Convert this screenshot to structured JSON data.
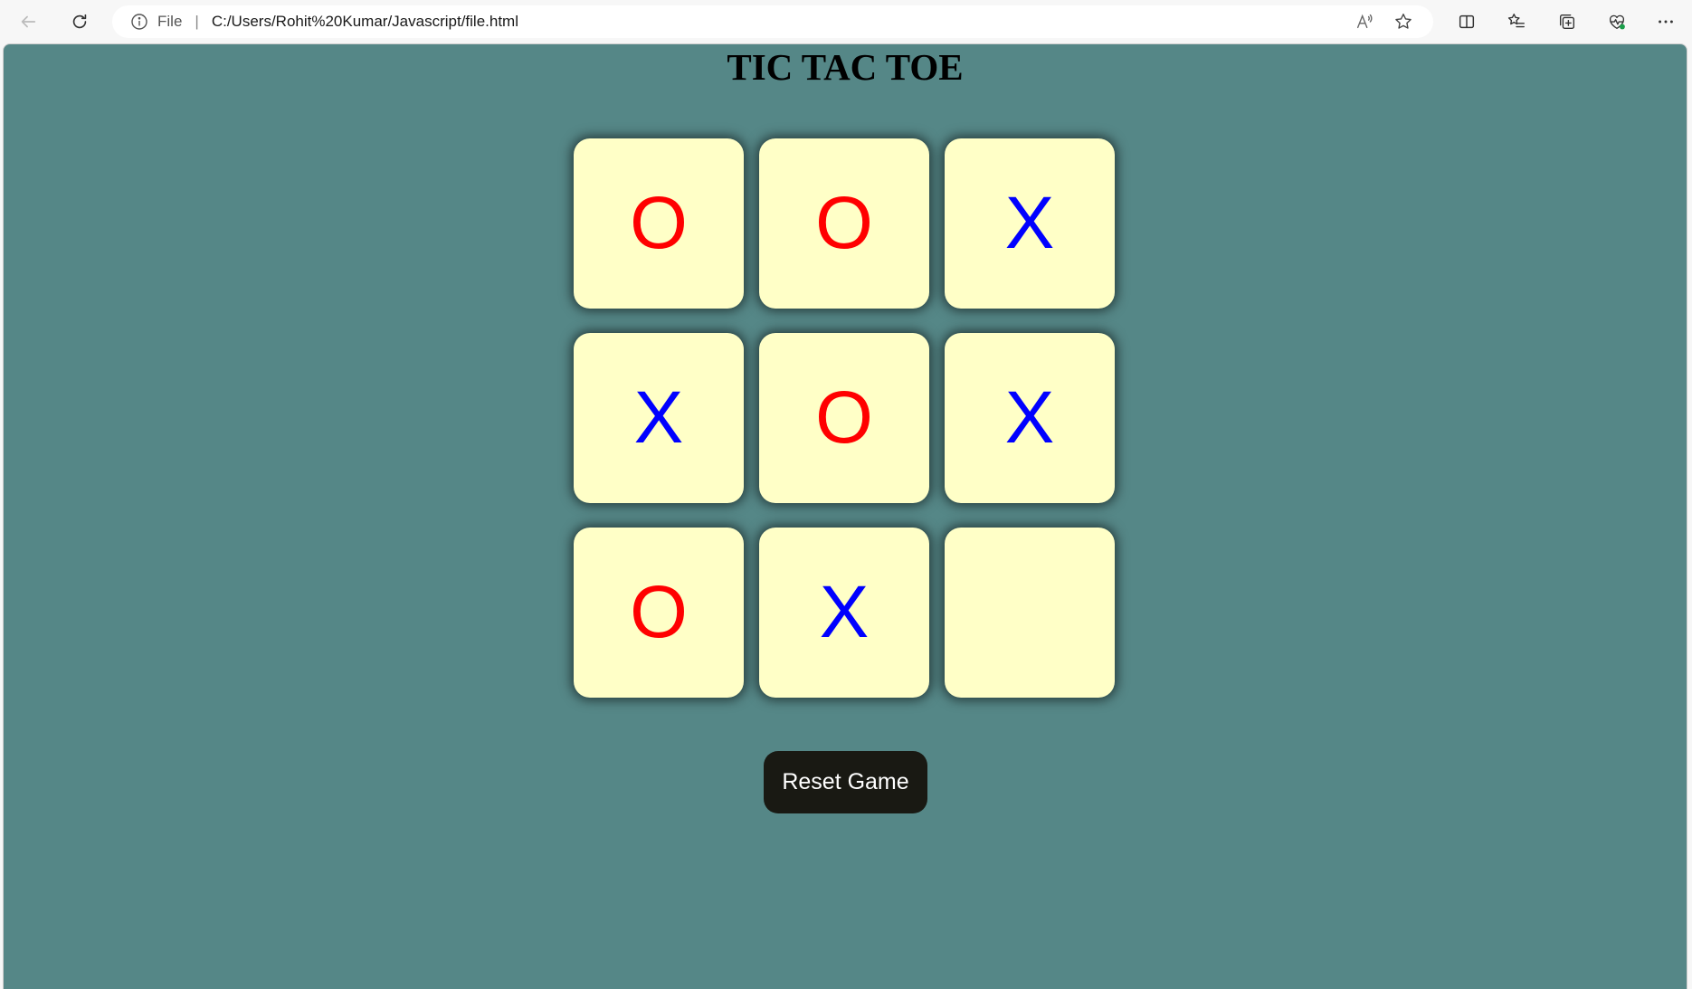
{
  "browser": {
    "address_scheme": "File",
    "address_separator": "|",
    "url": "C:/Users/Rohit%20Kumar/Javascript/file.html",
    "icons": {
      "back": "back-arrow-icon",
      "refresh": "refresh-icon",
      "info": "info-icon",
      "read_aloud": "read-aloud-icon",
      "favorite": "star-icon",
      "split_screen": "split-screen-icon",
      "favorites": "favorites-list-icon",
      "collections": "collections-icon",
      "browser_essentials": "heart-pulse-icon",
      "more": "more-dots-icon"
    }
  },
  "game": {
    "title": "TIC TAC TOE",
    "board": [
      [
        "O",
        "O",
        "X"
      ],
      [
        "X",
        "O",
        "X"
      ],
      [
        "O",
        "X",
        ""
      ]
    ],
    "colors": {
      "O": "#ff0000",
      "X": "#0000ff",
      "cell_background": "#ffffc7",
      "page_background": "#558787"
    },
    "reset_label": "Reset Game"
  }
}
